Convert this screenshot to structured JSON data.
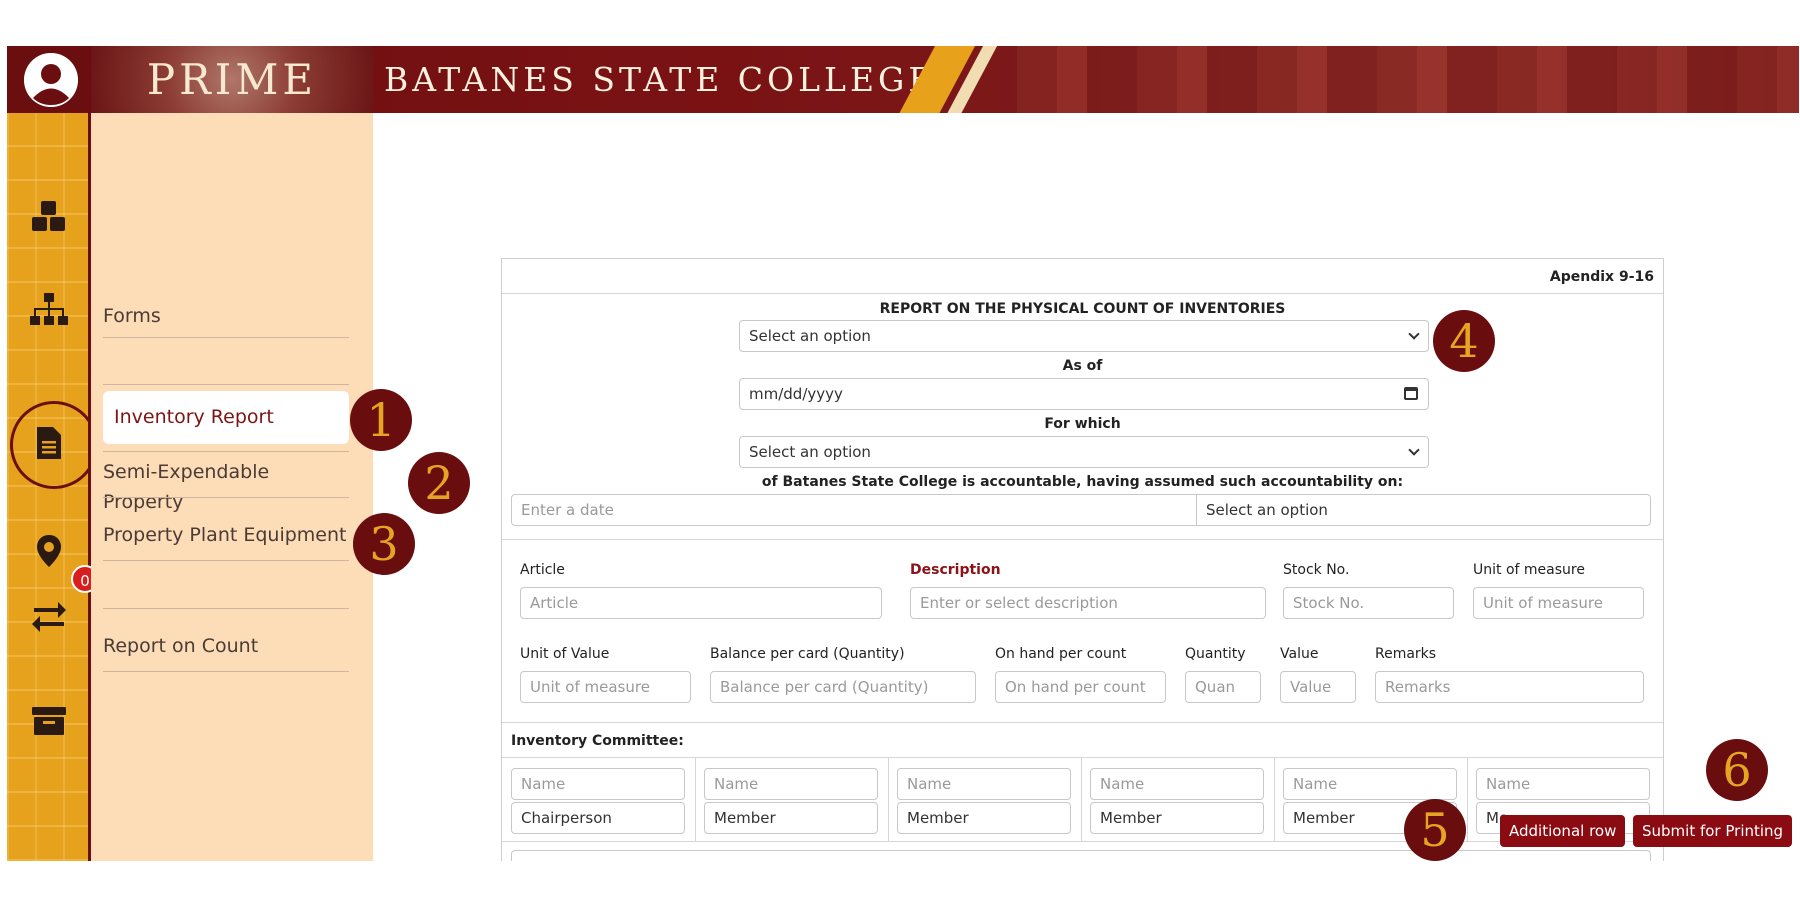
{
  "header": {
    "app_logo": "PRIME",
    "college_name": "BATANES STATE COLLEGE"
  },
  "rail": {
    "icons": [
      "boxes-icon",
      "sitemap-icon",
      "file-icon",
      "location-pin-icon",
      "transfer-arrows-icon",
      "archive-box-icon"
    ],
    "transfer_badge": "0"
  },
  "sidemenu": {
    "forms": "Forms",
    "inventory_report": "Inventory Report",
    "semi_expendable": "Semi-Expendable Property",
    "ppe": "Property Plant Equipment",
    "report_on_count": "Report on Count"
  },
  "markers": [
    "1",
    "2",
    "3",
    "4",
    "5",
    "6"
  ],
  "form": {
    "appendix": "Apendix 9-16",
    "title": "REPORT ON THE PHYSICAL COUNT OF INVENTORIES",
    "report_select": "Select an option",
    "as_of_label": "As of",
    "date_value": "mm/dd/yyyy",
    "for_which_label": "For which",
    "for_which_select": "Select an option",
    "accountable_label": "of Batanes State College is accountable, having assumed such accountability on:",
    "accountable_date_placeholder": "Enter a date",
    "accountable_select": "Select an option",
    "article_label": "Article",
    "article_placeholder": "Article",
    "description_label": "Description",
    "description_placeholder": "Enter or select description",
    "stock_label": "Stock No.",
    "stock_placeholder": "Stock No.",
    "uom_label": "Unit of measure",
    "uom_placeholder": "Unit of measure",
    "unit_value_label": "Unit of Value",
    "unit_value_placeholder": "Unit of measure",
    "balance_label": "Balance per card (Quantity)",
    "balance_placeholder": "Balance per card (Quantity)",
    "onhand_label": "On hand per count",
    "onhand_placeholder": "On hand per count",
    "quantity_label": "Quantity",
    "quantity_placeholder": "Quan",
    "value_label": "Value",
    "value_placeholder": "Value",
    "remarks_label": "Remarks",
    "remarks_placeholder": "Remarks",
    "committee_label": "Inventory Committee:",
    "committee": [
      {
        "name_placeholder": "Name",
        "role": "Chairperson"
      },
      {
        "name_placeholder": "Name",
        "role": "Member"
      },
      {
        "name_placeholder": "Name",
        "role": "Member"
      },
      {
        "name_placeholder": "Name",
        "role": "Member"
      },
      {
        "name_placeholder": "Name",
        "role": "Member"
      },
      {
        "name_placeholder": "Name",
        "role": "Me"
      }
    ]
  },
  "buttons": {
    "additional_row": "Additional row",
    "submit_printing": "Submit for Printing"
  },
  "colors": {
    "brand_maroon": "#7a1214",
    "accent_gold": "#e7a21d",
    "sidebar_peach": "#fddcb8",
    "button_red": "#8b0b12"
  }
}
